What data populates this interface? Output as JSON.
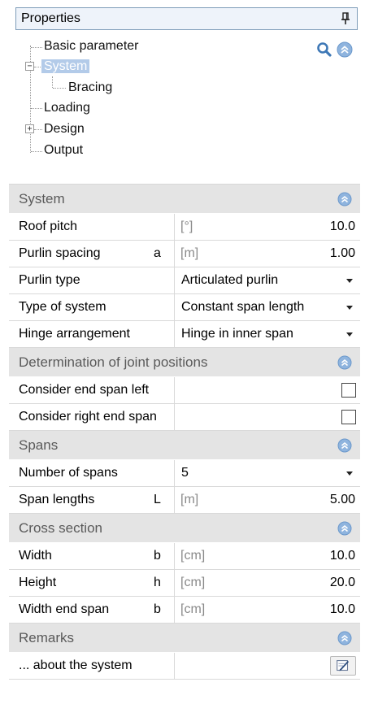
{
  "panel": {
    "title": "Properties"
  },
  "tree": {
    "items": [
      {
        "label": "Basic parameter"
      },
      {
        "label": "System"
      },
      {
        "label": "Bracing"
      },
      {
        "label": "Loading"
      },
      {
        "label": "Design"
      },
      {
        "label": "Output"
      }
    ]
  },
  "icons": {
    "pin": "pin-icon",
    "search": "search-icon",
    "collapse": "collapse-all-icon",
    "section_chevron": "chevron-up-icon",
    "edit": "edit-note-icon"
  },
  "colors": {
    "accent": "#7fa7d6",
    "section_bg": "#e4e4e4",
    "selected": "#b3cbe9"
  },
  "sections": [
    {
      "title": "System",
      "rows": [
        {
          "name": "Roof pitch",
          "symbol": "",
          "unit": "[°]",
          "value": "10.0",
          "kind": "number"
        },
        {
          "name": "Purlin spacing",
          "symbol": "a",
          "unit": "[m]",
          "value": "1.00",
          "kind": "number"
        },
        {
          "name": "Purlin type",
          "symbol": "",
          "unit": "",
          "value": "Articulated purlin",
          "kind": "select"
        },
        {
          "name": "Type of system",
          "symbol": "",
          "unit": "",
          "value": "Constant span length",
          "kind": "select"
        },
        {
          "name": "Hinge arrangement",
          "symbol": "",
          "unit": "",
          "value": "Hinge in inner span",
          "kind": "select"
        }
      ]
    },
    {
      "title": "Determination of joint positions",
      "rows": [
        {
          "name": "Consider end span left",
          "symbol": "",
          "unit": "",
          "value": "",
          "kind": "checkbox"
        },
        {
          "name": "Consider right end span",
          "symbol": "",
          "unit": "",
          "value": "",
          "kind": "checkbox"
        }
      ]
    },
    {
      "title": "Spans",
      "rows": [
        {
          "name": "Number of spans",
          "symbol": "",
          "unit": "",
          "value": "5",
          "kind": "select"
        },
        {
          "name": "Span lengths",
          "symbol": "L",
          "unit": "[m]",
          "value": "5.00",
          "kind": "number"
        }
      ]
    },
    {
      "title": "Cross section",
      "rows": [
        {
          "name": "Width",
          "symbol": "b",
          "unit": "[cm]",
          "value": "10.0",
          "kind": "number"
        },
        {
          "name": "Height",
          "symbol": "h",
          "unit": "[cm]",
          "value": "20.0",
          "kind": "number"
        },
        {
          "name": "Width end span",
          "symbol": "b",
          "unit": "[cm]",
          "value": "10.0",
          "kind": "number"
        }
      ]
    },
    {
      "title": "Remarks",
      "rows": [
        {
          "name": "... about the system",
          "symbol": "",
          "unit": "",
          "value": "",
          "kind": "button"
        }
      ]
    }
  ]
}
